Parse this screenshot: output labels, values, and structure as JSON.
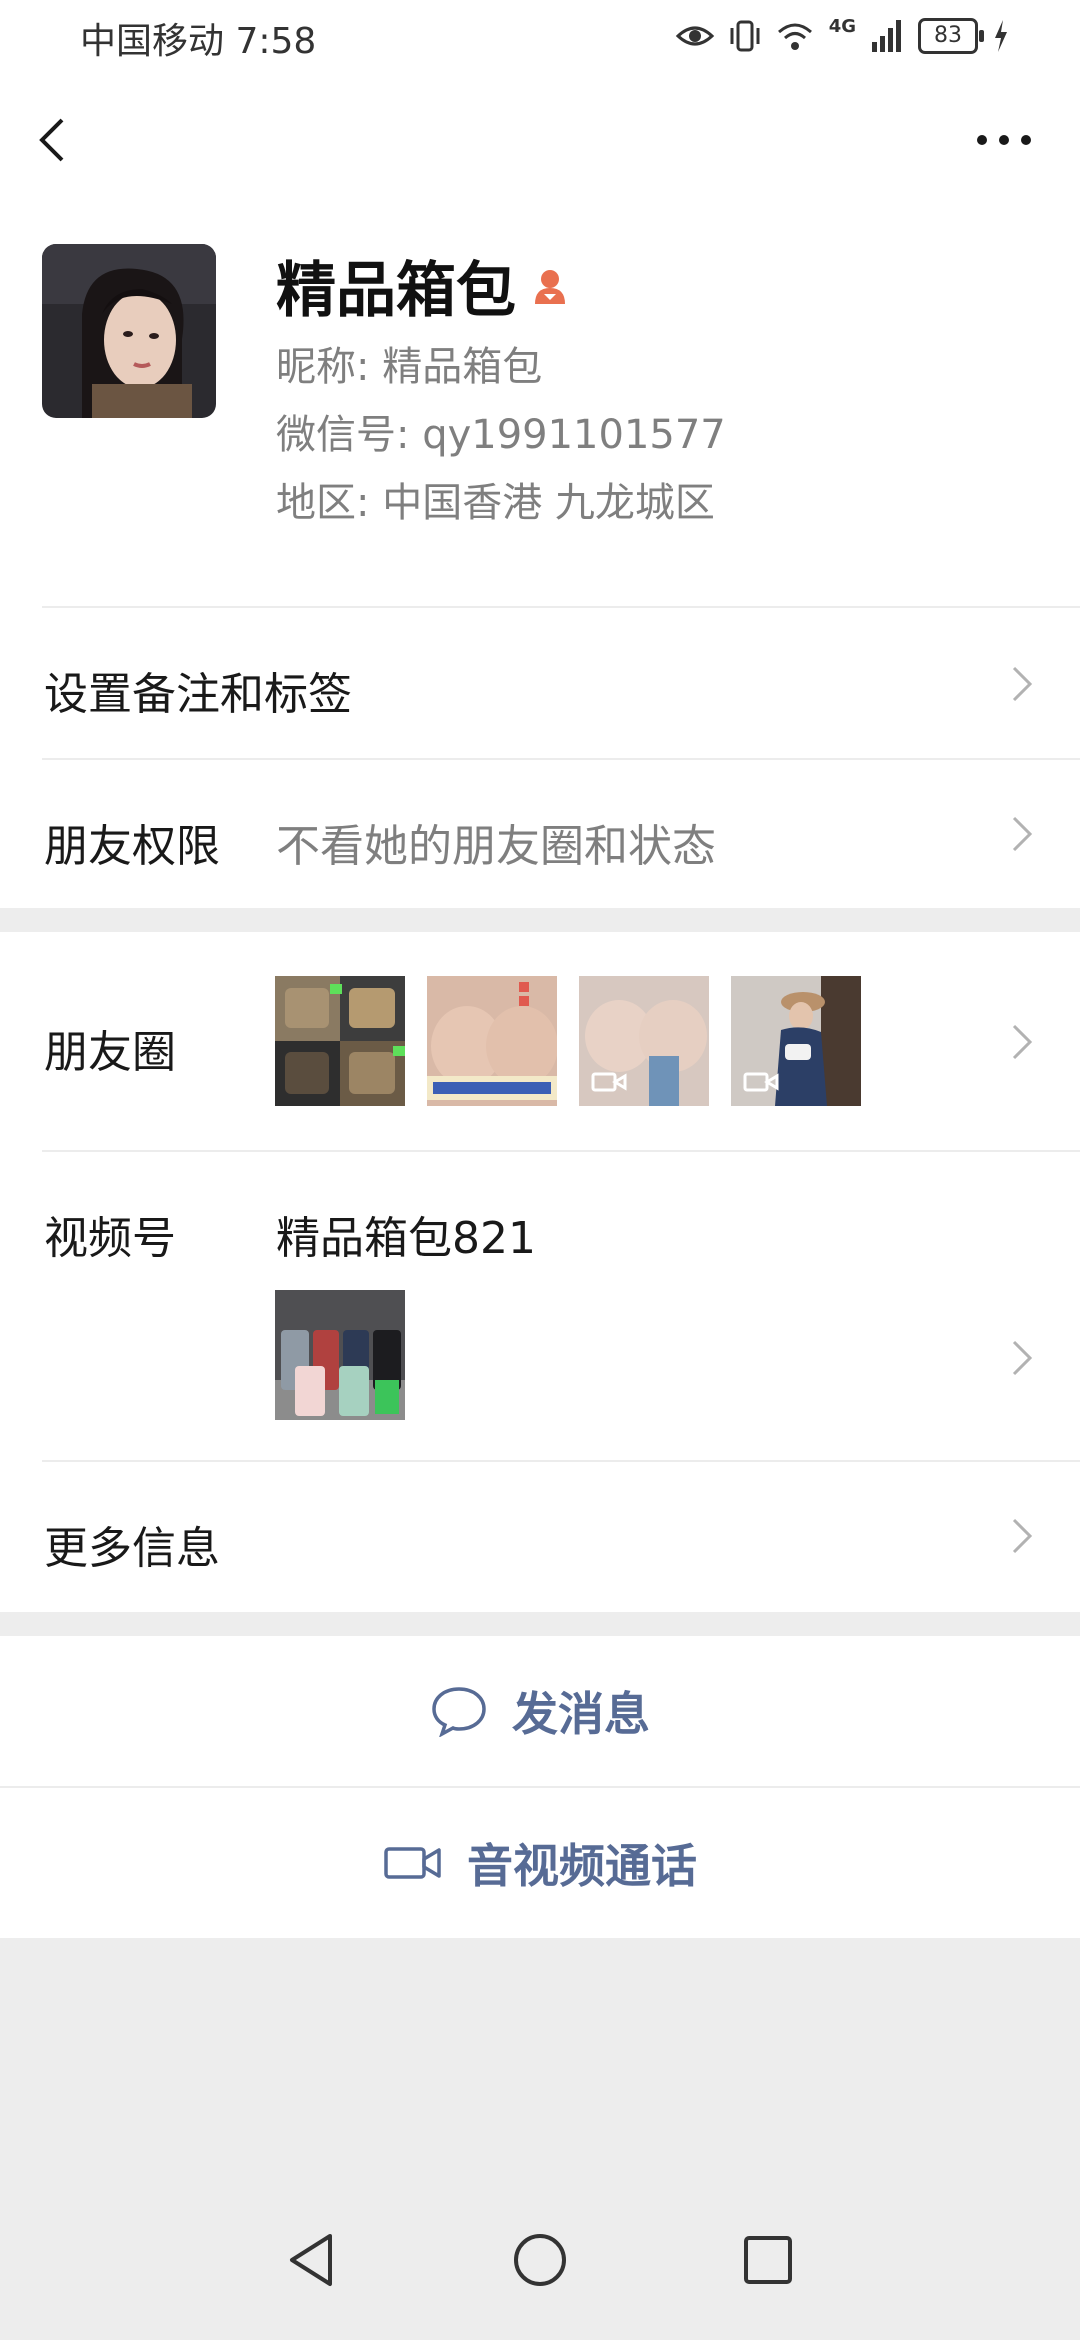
{
  "status": {
    "carrier_time": "中国移动 7:58",
    "network": "4G",
    "battery": "83"
  },
  "profile": {
    "name": "精品箱包",
    "nickname": "昵称:  精品箱包",
    "wechat_id": "微信号:  qy1991101577",
    "region": "地区:  中国香港  九龙城区"
  },
  "rows": {
    "remark": {
      "label": "设置备注和标签"
    },
    "permission": {
      "label": "朋友权限",
      "value": "不看她的朋友圈和状态"
    },
    "moments": {
      "label": "朋友圈"
    },
    "channels": {
      "label": "视频号",
      "value": "精品箱包821"
    },
    "more": {
      "label": "更多信息"
    }
  },
  "actions": {
    "message": "发消息",
    "call": "音视频通话"
  },
  "colors": {
    "link": "#576b95",
    "gender_badge": "#e9704f",
    "background": "#ededed"
  }
}
